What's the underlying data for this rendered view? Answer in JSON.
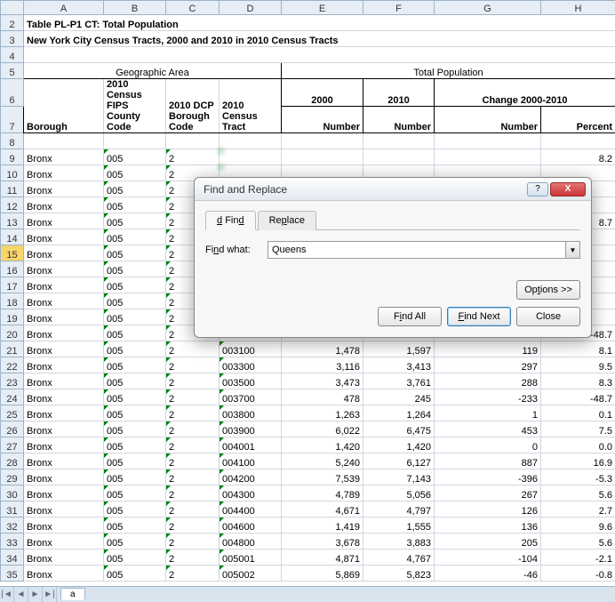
{
  "columns": [
    "A",
    "B",
    "C",
    "D",
    "E",
    "F",
    "G",
    "H"
  ],
  "title1": "Table PL-P1 CT:  Total Population",
  "title2": "New York City Census Tracts, 2000 and 2010 in 2010 Census Tracts",
  "hdr_geo": "Geographic Area",
  "hdr_pop": "Total Population",
  "hdr_2000": "2000",
  "hdr_2010": "2010",
  "hdr_change": "Change 2000-2010",
  "hdr_borough": "Borough",
  "hdr_fips": "2010 Census FIPS County Code",
  "hdr_dcp": "2010 DCP Borough Code",
  "hdr_tract": "2010 Census Tract",
  "hdr_number": "Number",
  "hdr_percent": "Percent",
  "rows": [
    {
      "n": 9,
      "a": "Bronx",
      "b": "005",
      "c": "2",
      "blur": true,
      "h": "8.2"
    },
    {
      "n": 10,
      "a": "Bronx",
      "b": "005",
      "c": "2",
      "blur": true
    },
    {
      "n": 11,
      "a": "Bronx",
      "b": "005",
      "c": "2",
      "blur": true
    },
    {
      "n": 12,
      "a": "Bronx",
      "b": "005",
      "c": "2",
      "blur": true
    },
    {
      "n": 13,
      "a": "Bronx",
      "b": "005",
      "c": "2",
      "blur": true,
      "h": "8.7"
    },
    {
      "n": 14,
      "a": "Bronx",
      "b": "005",
      "c": "2",
      "blur": true
    },
    {
      "n": 15,
      "a": "Bronx",
      "b": "005",
      "c": "2",
      "blur": true,
      "sel": true
    },
    {
      "n": 16,
      "a": "Bronx",
      "b": "005",
      "c": "2",
      "blur": true
    },
    {
      "n": 17,
      "a": "Bronx",
      "b": "005",
      "c": "2",
      "blur": true
    },
    {
      "n": 18,
      "a": "Bronx",
      "b": "005",
      "c": "2",
      "blur": true
    },
    {
      "n": 19,
      "a": "Bronx",
      "b": "005",
      "c": "2",
      "blur": true
    },
    {
      "n": 20,
      "a": "Bronx",
      "b": "005",
      "c": "2",
      "blur": true,
      "h": "-48.7"
    },
    {
      "n": 21,
      "a": "Bronx",
      "b": "005",
      "c": "2",
      "d": "003100",
      "e": "1,478",
      "f": "1,597",
      "g": "119",
      "h": "8.1"
    },
    {
      "n": 22,
      "a": "Bronx",
      "b": "005",
      "c": "2",
      "d": "003300",
      "e": "3,116",
      "f": "3,413",
      "g": "297",
      "h": "9.5"
    },
    {
      "n": 23,
      "a": "Bronx",
      "b": "005",
      "c": "2",
      "d": "003500",
      "e": "3,473",
      "f": "3,761",
      "g": "288",
      "h": "8.3"
    },
    {
      "n": 24,
      "a": "Bronx",
      "b": "005",
      "c": "2",
      "d": "003700",
      "e": "478",
      "f": "245",
      "g": "-233",
      "h": "-48.7"
    },
    {
      "n": 25,
      "a": "Bronx",
      "b": "005",
      "c": "2",
      "d": "003800",
      "e": "1,263",
      "f": "1,264",
      "g": "1",
      "h": "0.1"
    },
    {
      "n": 26,
      "a": "Bronx",
      "b": "005",
      "c": "2",
      "d": "003900",
      "e": "6,022",
      "f": "6,475",
      "g": "453",
      "h": "7.5"
    },
    {
      "n": 27,
      "a": "Bronx",
      "b": "005",
      "c": "2",
      "d": "004001",
      "e": "1,420",
      "f": "1,420",
      "g": "0",
      "h": "0.0"
    },
    {
      "n": 28,
      "a": "Bronx",
      "b": "005",
      "c": "2",
      "d": "004100",
      "e": "5,240",
      "f": "6,127",
      "g": "887",
      "h": "16.9"
    },
    {
      "n": 29,
      "a": "Bronx",
      "b": "005",
      "c": "2",
      "d": "004200",
      "e": "7,539",
      "f": "7,143",
      "g": "-396",
      "h": "-5.3"
    },
    {
      "n": 30,
      "a": "Bronx",
      "b": "005",
      "c": "2",
      "d": "004300",
      "e": "4,789",
      "f": "5,056",
      "g": "267",
      "h": "5.6"
    },
    {
      "n": 31,
      "a": "Bronx",
      "b": "005",
      "c": "2",
      "d": "004400",
      "e": "4,671",
      "f": "4,797",
      "g": "126",
      "h": "2.7"
    },
    {
      "n": 32,
      "a": "Bronx",
      "b": "005",
      "c": "2",
      "d": "004600",
      "e": "1,419",
      "f": "1,555",
      "g": "136",
      "h": "9.6"
    },
    {
      "n": 33,
      "a": "Bronx",
      "b": "005",
      "c": "2",
      "d": "004800",
      "e": "3,678",
      "f": "3,883",
      "g": "205",
      "h": "5.6"
    },
    {
      "n": 34,
      "a": "Bronx",
      "b": "005",
      "c": "2",
      "d": "005001",
      "e": "4,871",
      "f": "4,767",
      "g": "-104",
      "h": "-2.1"
    },
    {
      "n": 35,
      "a": "Bronx",
      "b": "005",
      "c": "2",
      "d": "005002",
      "e": "5,869",
      "f": "5,823",
      "g": "-46",
      "h": "-0.8"
    }
  ],
  "dialog": {
    "title": "Find and Replace",
    "tab_find": "Find",
    "tab_replace": "Replace",
    "find_what_label": "Find what:",
    "find_what_value": "Queens",
    "options": "Options >>",
    "find_all": "Find All",
    "find_next": "Find Next",
    "close": "Close",
    "help": "?",
    "x": "X"
  },
  "sheet_tab": "a",
  "nav": {
    "first": "|◄",
    "prev": "◄",
    "next": "►",
    "last": "►|"
  }
}
